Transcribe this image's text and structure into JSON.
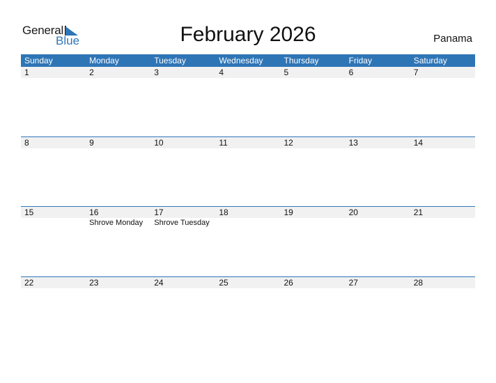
{
  "logo": {
    "word1": "General",
    "word2": "Blue",
    "accent_color": "#2e75b6"
  },
  "title": "February 2026",
  "country": "Panama",
  "calendar": {
    "header_color": "#2e75b6",
    "weekdays": [
      "Sunday",
      "Monday",
      "Tuesday",
      "Wednesday",
      "Thursday",
      "Friday",
      "Saturday"
    ],
    "weeks": [
      {
        "days": [
          {
            "num": "1",
            "event": ""
          },
          {
            "num": "2",
            "event": ""
          },
          {
            "num": "3",
            "event": ""
          },
          {
            "num": "4",
            "event": ""
          },
          {
            "num": "5",
            "event": ""
          },
          {
            "num": "6",
            "event": ""
          },
          {
            "num": "7",
            "event": ""
          }
        ]
      },
      {
        "days": [
          {
            "num": "8",
            "event": ""
          },
          {
            "num": "9",
            "event": ""
          },
          {
            "num": "10",
            "event": ""
          },
          {
            "num": "11",
            "event": ""
          },
          {
            "num": "12",
            "event": ""
          },
          {
            "num": "13",
            "event": ""
          },
          {
            "num": "14",
            "event": ""
          }
        ]
      },
      {
        "days": [
          {
            "num": "15",
            "event": ""
          },
          {
            "num": "16",
            "event": "Shrove Monday"
          },
          {
            "num": "17",
            "event": "Shrove Tuesday"
          },
          {
            "num": "18",
            "event": ""
          },
          {
            "num": "19",
            "event": ""
          },
          {
            "num": "20",
            "event": ""
          },
          {
            "num": "21",
            "event": ""
          }
        ]
      },
      {
        "days": [
          {
            "num": "22",
            "event": ""
          },
          {
            "num": "23",
            "event": ""
          },
          {
            "num": "24",
            "event": ""
          },
          {
            "num": "25",
            "event": ""
          },
          {
            "num": "26",
            "event": ""
          },
          {
            "num": "27",
            "event": ""
          },
          {
            "num": "28",
            "event": ""
          }
        ]
      }
    ]
  }
}
